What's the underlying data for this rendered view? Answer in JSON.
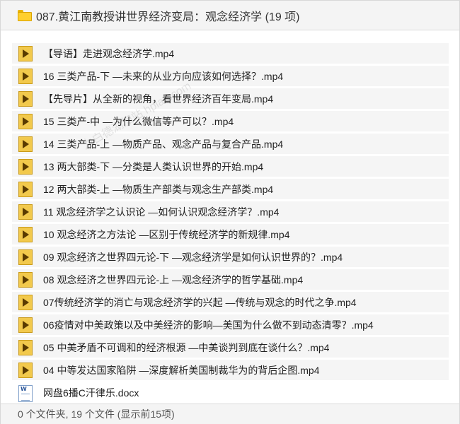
{
  "header": {
    "title": "087.黄江南教授讲世界经济变局：观念经济学 (19 项)",
    "icon": "folder-icon",
    "icon_color": "#ffcf2e"
  },
  "files": [
    {
      "name": "【导语】走进观念经济学.mp4",
      "type": "video"
    },
    {
      "name": "16 三类产品-下 —未来的从业方向应该如何选择？.mp4",
      "type": "video"
    },
    {
      "name": "【先导片】从全新的视角，看世界经济百年变局.mp4",
      "type": "video"
    },
    {
      "name": "15 三类产-中 —为什么微信等产可以？.mp4",
      "type": "video"
    },
    {
      "name": "14 三类产品-上 —物质产品、观念产品与复合产品.mp4",
      "type": "video"
    },
    {
      "name": "13 两大部类-下 —分类是人类认识世界的开始.mp4",
      "type": "video"
    },
    {
      "name": "12 两大部类-上 —物质生产部类与观念生产部类.mp4",
      "type": "video"
    },
    {
      "name": "11 观念经济学之认识论 —如何认识观念经济学？.mp4",
      "type": "video"
    },
    {
      "name": "10 观念经济之方法论 —区别于传统经济学的新规律.mp4",
      "type": "video"
    },
    {
      "name": "09 观念经济之世界四元论-下 —观念经济学是如何认识世界的？.mp4",
      "type": "video"
    },
    {
      "name": "08 观念经济之世界四元论-上 —观念经济学的哲学基础.mp4",
      "type": "video"
    },
    {
      "name": "07传统经济学的消亡与观念经济学的兴起 —传统与观念的时代之争.mp4",
      "type": "video"
    },
    {
      "name": "06疫情对中美政策以及中美经济的影响—美国为什么做不到动态清零？.mp4",
      "type": "video"
    },
    {
      "name": "05 中美矛盾不可调和的经济根源 —中美谈判到底在谈什么？.mp4",
      "type": "video"
    },
    {
      "name": "04 中等发达国家陷阱 —深度解析美国制裁华为的背后企图.mp4",
      "type": "video"
    },
    {
      "name": "网盘6播C汗律乐.docx",
      "type": "doc"
    }
  ],
  "footer": {
    "status": "0 个文件夹, 19 个文件 (显示前15项)"
  },
  "watermark": "为白德湖加站 hpiao.com",
  "colors": {
    "row_bg": "#f5f5f5",
    "video_icon": "#f2c94c",
    "header_bg": "#f4f4f4"
  }
}
